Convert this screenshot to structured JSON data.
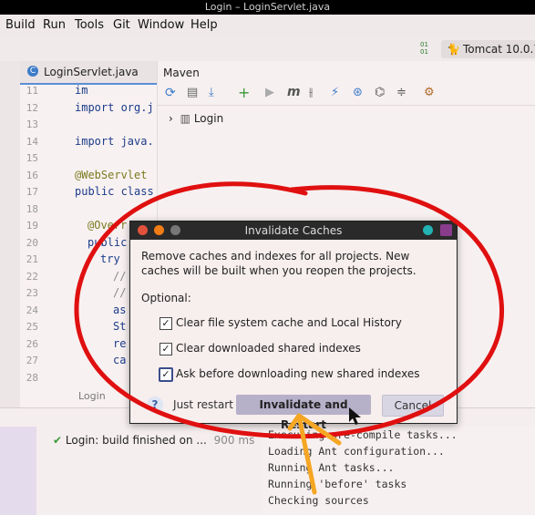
{
  "window": {
    "title": "Login – LoginServlet.java"
  },
  "menu": [
    "Build",
    "Run",
    "Tools",
    "Git",
    "Window",
    "Help"
  ],
  "toolbar": {
    "run_config": "Tomcat 10.0.7"
  },
  "editor": {
    "tab_label": "LoginServlet.java",
    "line_numbers": [
      "11",
      "12",
      "13",
      "14",
      "15",
      "16",
      "17",
      "18",
      "19",
      "20",
      "21",
      "22",
      "23",
      "24",
      "25",
      "26",
      "27",
      "28"
    ],
    "lines": [
      "im",
      "import org.j",
      "",
      "import java.",
      "",
      "@WebServlet",
      "public class",
      "",
      "@Overr",
      "public",
      "try",
      "//",
      "//",
      "as",
      "St",
      "re",
      "ca",
      ""
    ],
    "bottom_tab": "Login"
  },
  "maven": {
    "title": "Maven",
    "tree_root": "Login"
  },
  "dialog": {
    "title": "Invalidate Caches",
    "message": "Remove caches and indexes for all projects. New caches will be built when you reopen the projects.",
    "optional_label": "Optional:",
    "options": [
      {
        "label": "Clear file system cache and Local History",
        "checked": true
      },
      {
        "label": "Clear downloaded shared indexes",
        "checked": true
      },
      {
        "label": "Ask before downloading new shared indexes",
        "checked": true
      }
    ],
    "help_label": "?",
    "just_restart": "Just restart",
    "primary": "Invalidate and Restart",
    "cancel": "Cancel"
  },
  "build": {
    "status": "Login: build finished on ...",
    "duration": "900 ms"
  },
  "console": [
    "Executing pre-compile tasks...",
    "Loading Ant configuration...",
    "Running Ant tasks...",
    "Running 'before' tasks",
    "Checking sources"
  ],
  "colors": {
    "accent": "#5a8dd6",
    "annotation_red": "#e01010",
    "annotation_orange": "#f5a623",
    "primary_btn": "#b7b0c9"
  }
}
